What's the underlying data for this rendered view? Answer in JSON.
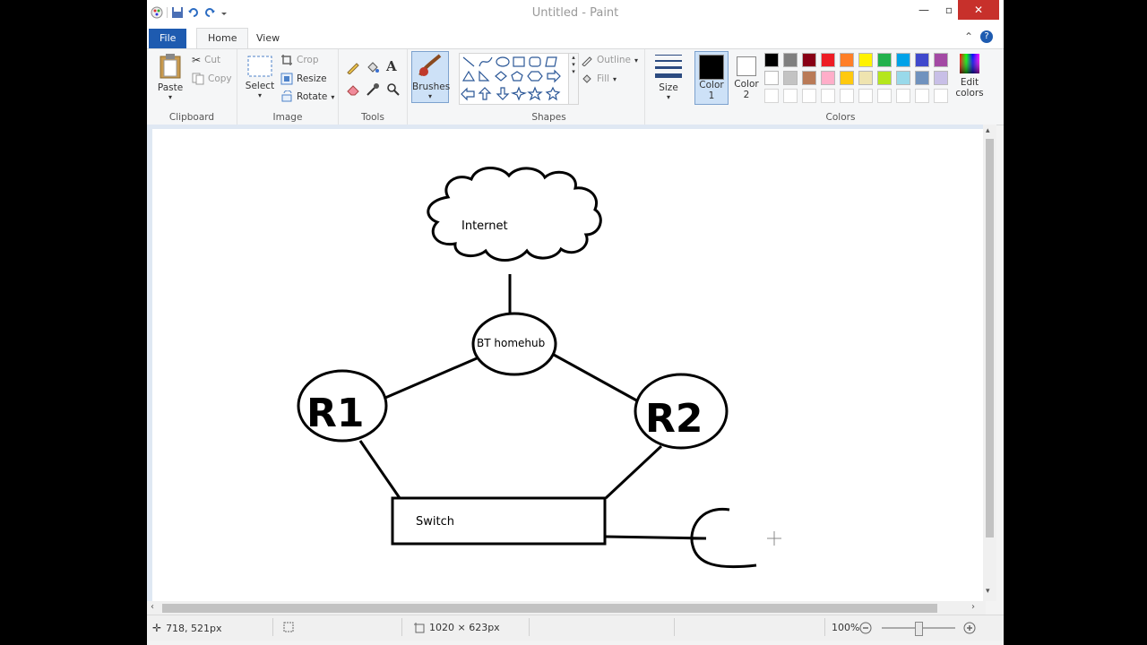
{
  "window": {
    "title": "Untitled - Paint"
  },
  "tabs": {
    "file": "File",
    "home": "Home",
    "view": "View"
  },
  "clipboard": {
    "paste": "Paste",
    "cut": "Cut",
    "copy": "Copy",
    "group": "Clipboard"
  },
  "image": {
    "select": "Select",
    "crop": "Crop",
    "resize": "Resize",
    "rotate": "Rotate",
    "group": "Image"
  },
  "tools": {
    "group": "Tools"
  },
  "brushes": {
    "label": "Brushes"
  },
  "shapes": {
    "outline": "Outline",
    "fill": "Fill",
    "group": "Shapes"
  },
  "size": {
    "label": "Size"
  },
  "colors": {
    "color1_label": "Color",
    "color1_num": "1",
    "color2_label": "Color",
    "color2_num": "2",
    "edit_line1": "Edit",
    "edit_line2": "colors",
    "group": "Colors",
    "color1": "#000000",
    "color2": "#ffffff",
    "palette_row1": [
      "#000000",
      "#7f7f7f",
      "#880015",
      "#ed1c24",
      "#ff7f27",
      "#fff200",
      "#22b14c",
      "#00a2e8",
      "#3f48cc",
      "#a349a4"
    ],
    "palette_row2": [
      "#ffffff",
      "#c3c3c3",
      "#b97a57",
      "#ffaec9",
      "#ffc90e",
      "#efe4b0",
      "#b5e61d",
      "#99d9ea",
      "#7092be",
      "#c8bfe7"
    ],
    "palette_row3": [
      "#ffffff",
      "#ffffff",
      "#ffffff",
      "#ffffff",
      "#ffffff",
      "#ffffff",
      "#ffffff",
      "#ffffff",
      "#ffffff",
      "#ffffff"
    ]
  },
  "drawing": {
    "cloud_label": "Internet",
    "hub_label": "BT homehub",
    "r1_label": "R1",
    "r2_label": "R2",
    "switch_label": "Switch"
  },
  "status": {
    "cursor_pos": "718, 521px",
    "canvas_size": "1020 × 623px",
    "zoom": "100%"
  }
}
